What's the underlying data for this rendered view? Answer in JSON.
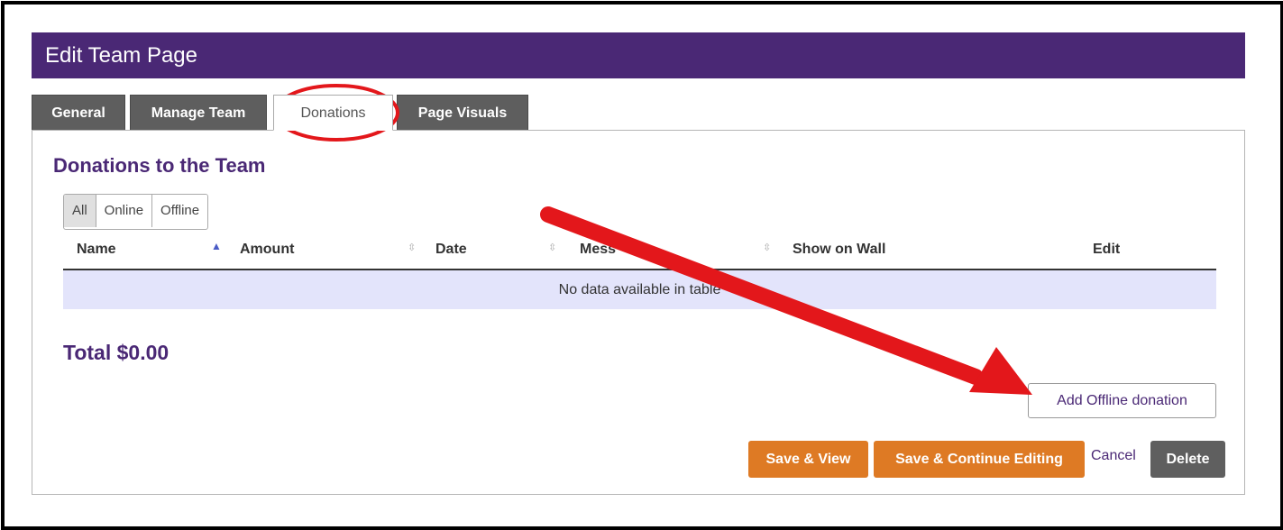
{
  "page": {
    "title": "Edit Team Page"
  },
  "tabs": [
    {
      "label": "General",
      "active": false
    },
    {
      "label": "Manage Team",
      "active": false
    },
    {
      "label": "Donations",
      "active": true
    },
    {
      "label": "Page Visuals",
      "active": false
    }
  ],
  "section": {
    "title": "Donations to the Team"
  },
  "filters": [
    {
      "label": "All",
      "active": true
    },
    {
      "label": "Online",
      "active": false
    },
    {
      "label": "Offline",
      "active": false
    }
  ],
  "table": {
    "columns": [
      "Name",
      "Amount",
      "Date",
      "Mess",
      "Show on Wall",
      "Edit"
    ],
    "sorted_column": "Name",
    "sort_direction": "ascending",
    "empty_message": "No data available in table"
  },
  "total": "Total $0.00",
  "buttons": {
    "add_offline": "Add Offline donation",
    "save_view": "Save & View",
    "save_continue": "Save & Continue Editing",
    "cancel": "Cancel",
    "delete": "Delete"
  },
  "colors": {
    "brand_purple": "#4a2875",
    "action_orange": "#de7a24",
    "annotation_red": "#e3171b",
    "empty_row_bg": "#e3e4fb"
  }
}
